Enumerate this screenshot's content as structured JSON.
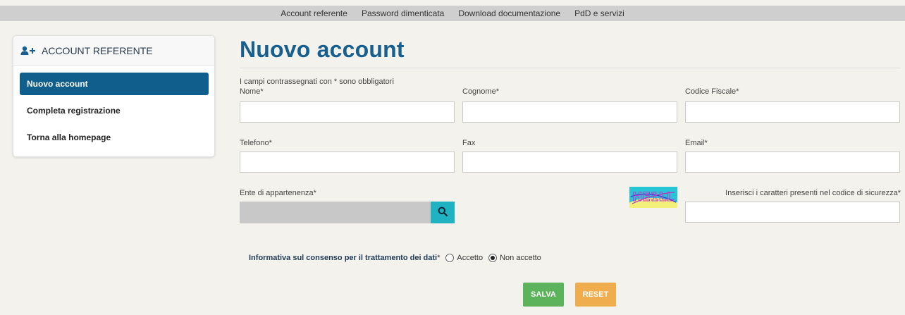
{
  "nav": {
    "items": [
      "Account referente",
      "Password dimenticata",
      "Download documentazione",
      "PdD e servizi"
    ]
  },
  "sidebar": {
    "header": "ACCOUNT REFERENTE",
    "header_icon": "user-plus-icon",
    "items": [
      {
        "label": "Nuovo account",
        "active": true
      },
      {
        "label": "Completa registrazione",
        "active": false
      },
      {
        "label": "Torna alla homepage",
        "active": false
      }
    ]
  },
  "main": {
    "title": "Nuovo account",
    "required_note": "I campi contrassegnati con * sono obbligatori",
    "fields": {
      "nome": {
        "label": "Nome*",
        "value": ""
      },
      "cognome": {
        "label": "Cognome*",
        "value": ""
      },
      "codice_fiscale": {
        "label": "Codice Fiscale*",
        "value": ""
      },
      "telefono": {
        "label": "Telefono*",
        "value": ""
      },
      "fax": {
        "label": "Fax",
        "value": ""
      },
      "email": {
        "label": "Email*",
        "value": ""
      },
      "ente": {
        "label": "Ente di appartenenza*",
        "value": ""
      },
      "captcha_input": {
        "label": "Inserisci i caratteri presenti nel codice di sicurezza*",
        "value": ""
      }
    },
    "captcha_text": "HE1LL",
    "consent": {
      "label": "Informativa sul consenso per il trattamento dei dati",
      "asterisk": "*",
      "options": [
        {
          "label": "Accetto",
          "checked": false
        },
        {
          "label": "Non accetto",
          "checked": true
        }
      ]
    },
    "buttons": {
      "save": "SALVA",
      "reset": "RESET"
    }
  },
  "colors": {
    "primary": "#175f8e",
    "sidebar_active": "#0f5e8b",
    "save": "#5cb35c",
    "reset": "#f0ad4e",
    "search": "#1fb3c2"
  }
}
